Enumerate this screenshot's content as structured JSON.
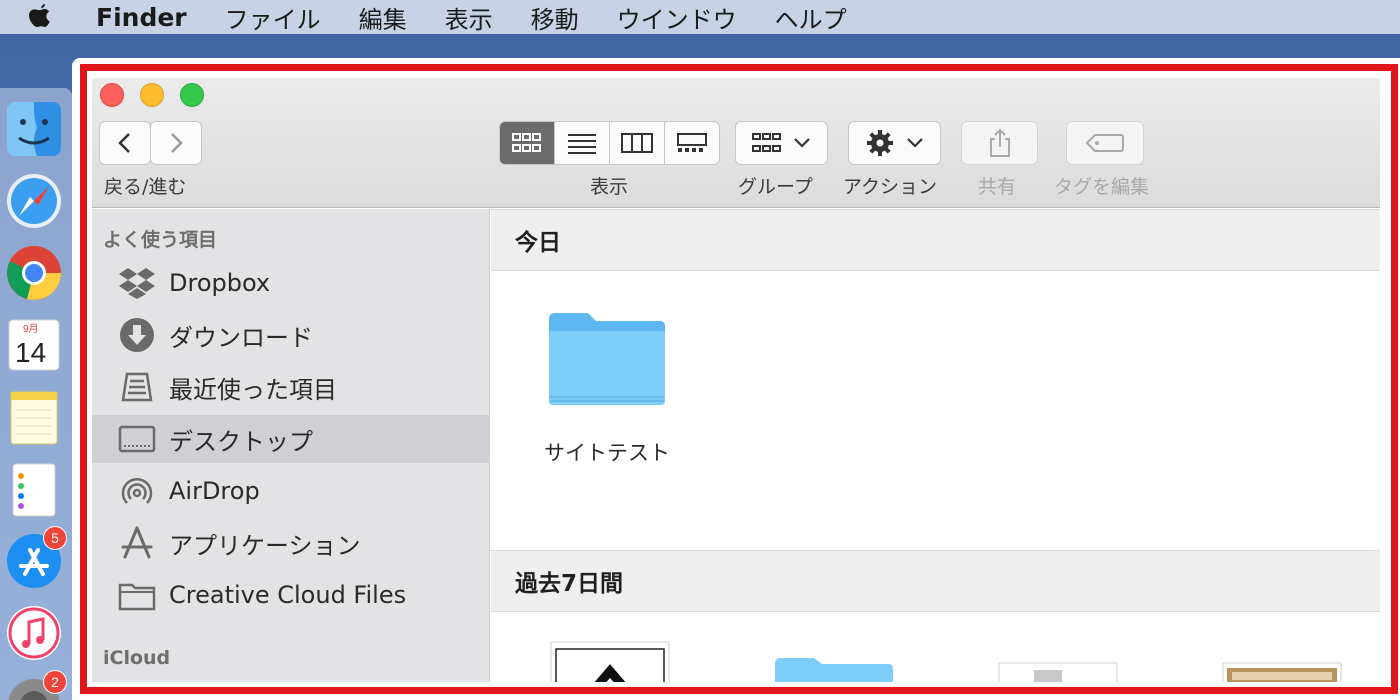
{
  "menubar": {
    "app_name": "Finder",
    "items": [
      "ファイル",
      "編集",
      "表示",
      "移動",
      "ウインドウ",
      "ヘルプ"
    ]
  },
  "dock": {
    "calendar_month": "9月",
    "calendar_day": "14",
    "appstore_badge": "5",
    "settings_badge": "2"
  },
  "toolbar": {
    "back_forward_label": "戻る/進む",
    "view_label": "表示",
    "group_label": "グループ",
    "action_label": "アクション",
    "share_label": "共有",
    "tags_label": "タグを編集"
  },
  "sidebar": {
    "favorites_heading": "よく使う項目",
    "items": [
      {
        "label": "Dropbox",
        "icon": "dropbox-icon"
      },
      {
        "label": "ダウンロード",
        "icon": "download-icon"
      },
      {
        "label": "最近使った項目",
        "icon": "recents-icon"
      },
      {
        "label": "デスクトップ",
        "icon": "desktop-icon",
        "selected": true
      },
      {
        "label": "AirDrop",
        "icon": "airdrop-icon"
      },
      {
        "label": "アプリケーション",
        "icon": "applications-icon"
      },
      {
        "label": "Creative Cloud Files",
        "icon": "folder-icon"
      }
    ],
    "icloud_heading": "iCloud"
  },
  "content": {
    "sections": [
      {
        "title": "今日",
        "items": [
          {
            "name": "サイトテスト",
            "type": "folder"
          }
        ]
      },
      {
        "title": "過去7日間",
        "items": [
          {
            "name": "",
            "type": "document"
          },
          {
            "name": "",
            "type": "folder"
          },
          {
            "name": "",
            "type": "image"
          },
          {
            "name": "",
            "type": "image"
          }
        ]
      }
    ]
  },
  "colors": {
    "highlight_border": "#e0161b",
    "folder_blue": "#6ec6f5",
    "sidebar_bg": "#e3e3e6",
    "selected_row": "#d0d0d4"
  }
}
